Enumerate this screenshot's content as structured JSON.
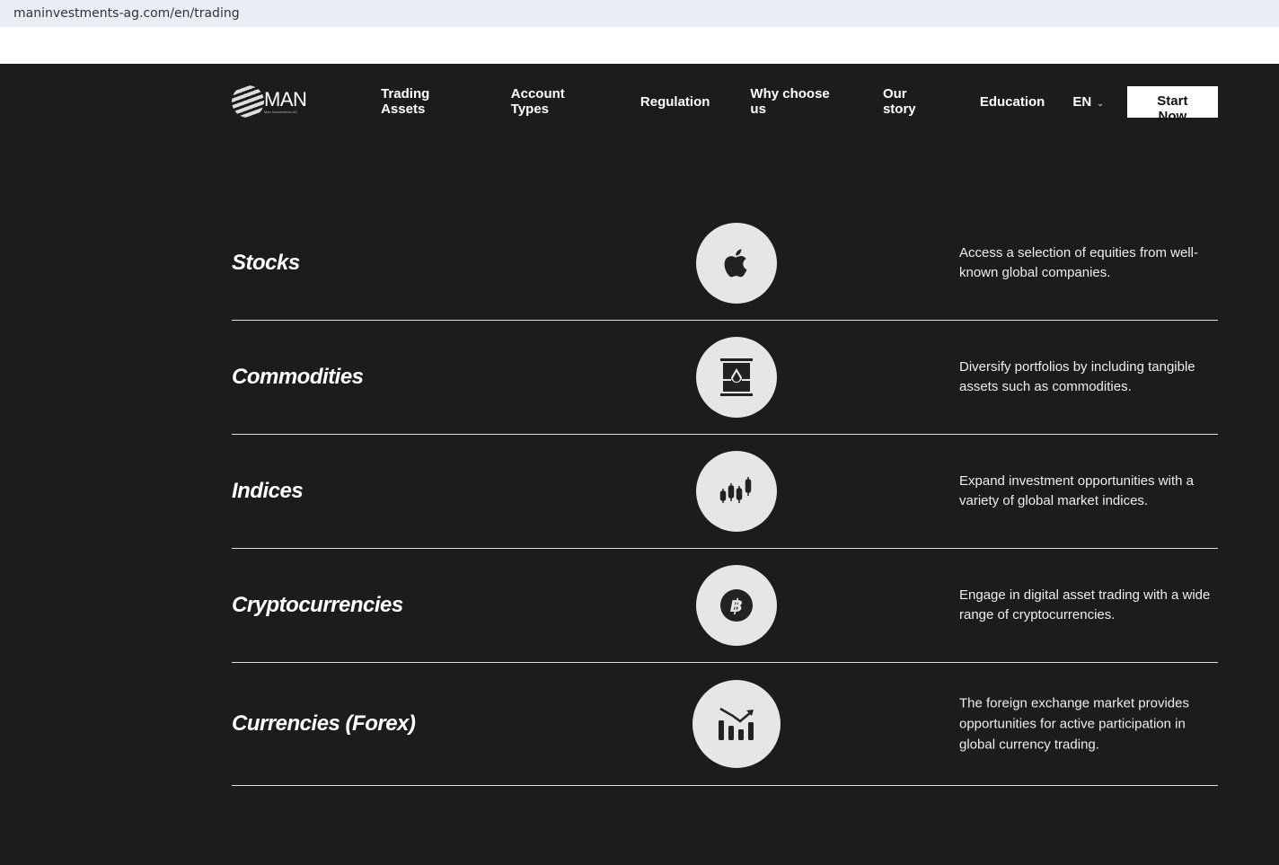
{
  "browser": {
    "url": "maninvestments-ag.com/en/trading"
  },
  "nav": {
    "logo_text": "MAN",
    "logo_sub": "Man Investments AG",
    "items": [
      "Trading Assets",
      "Account Types",
      "Regulation",
      "Why choose us",
      "Our story",
      "Education"
    ],
    "lang": "EN",
    "cta": "Start Now"
  },
  "assets": [
    {
      "title": "Stocks",
      "icon": "apple-icon",
      "desc": "Access a selection of equities from well-known global companies."
    },
    {
      "title": "Commodities",
      "icon": "oil-barrel-icon",
      "desc": "Diversify portfolios by including tangible assets such as commodities."
    },
    {
      "title": "Indices",
      "icon": "candlestick-icon",
      "desc": "Expand investment opportunities with a variety of global market indices."
    },
    {
      "title": "Cryptocurrencies",
      "icon": "bitcoin-icon",
      "desc": "Engage in digital asset trading with a wide range of cryptocurrencies."
    },
    {
      "title": "Currencies (Forex)",
      "icon": "bar-chart-trend-icon",
      "desc": "The foreign exchange market provides opportunities for active participation in global currency trading."
    }
  ]
}
